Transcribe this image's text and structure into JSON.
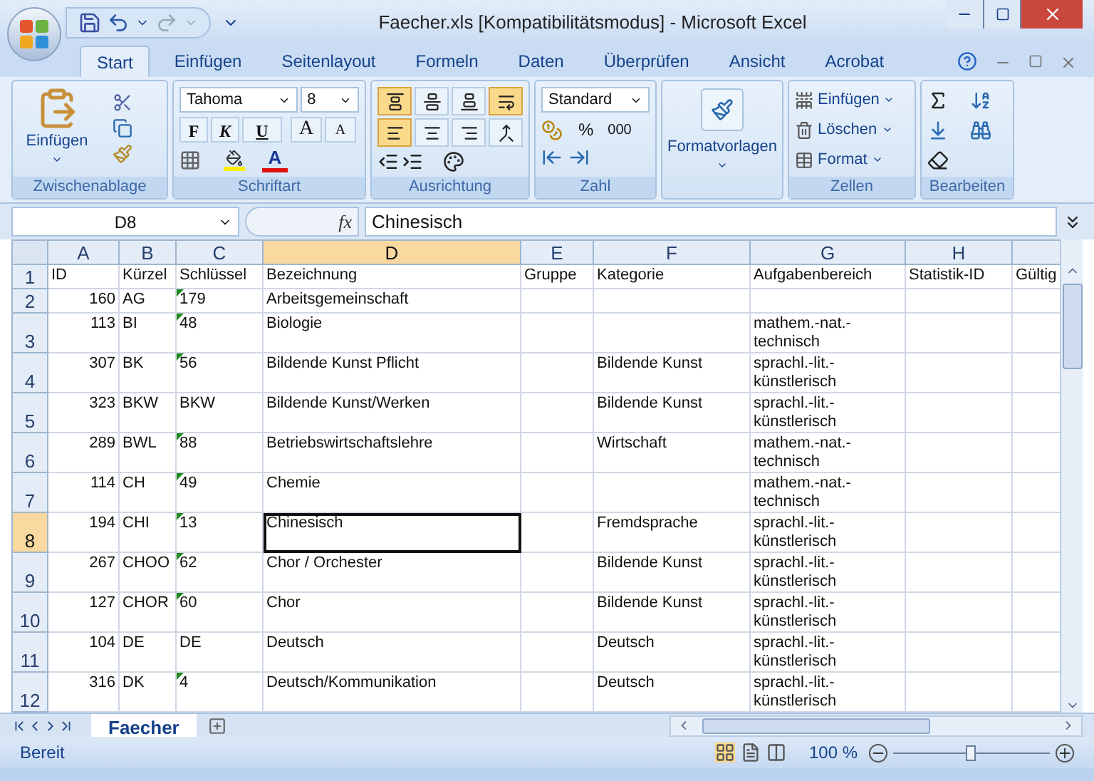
{
  "window": {
    "title": "Faecher.xls  [Kompatibilitätsmodus] - Microsoft Excel"
  },
  "tabs": [
    {
      "label": "Start",
      "selected": true
    },
    {
      "label": "Einfügen",
      "selected": false
    },
    {
      "label": "Seitenlayout",
      "selected": false
    },
    {
      "label": "Formeln",
      "selected": false
    },
    {
      "label": "Daten",
      "selected": false
    },
    {
      "label": "Überprüfen",
      "selected": false
    },
    {
      "label": "Ansicht",
      "selected": false
    },
    {
      "label": "Acrobat",
      "selected": false
    }
  ],
  "ribbon": {
    "clipboard": {
      "paste_label": "Einfügen",
      "group": "Zwischenablage"
    },
    "font": {
      "font_name": "Tahoma",
      "font_size": "8",
      "bold": "F",
      "italic": "K",
      "underline": "U",
      "grow": "A",
      "shrink": "A",
      "font_color": "A",
      "group": "Schriftart"
    },
    "alignment": {
      "buttons": [
        {
          "kind": "top",
          "selected": true
        },
        {
          "kind": "middle",
          "selected": false
        },
        {
          "kind": "bottom",
          "selected": false
        },
        {
          "kind": "wrap",
          "selected": true
        },
        {
          "kind": "left",
          "selected": true
        },
        {
          "kind": "center",
          "selected": false
        },
        {
          "kind": "right",
          "selected": false
        },
        {
          "kind": "merge",
          "selected": false
        }
      ],
      "group": "Ausrichtung"
    },
    "number": {
      "format": "Standard",
      "percent": "%",
      "thousands": "000",
      "group": "Zahl"
    },
    "styles": {
      "label": "Formatvorlagen"
    },
    "cells": {
      "items": [
        {
          "kind": "insert",
          "label": "Einfügen"
        },
        {
          "kind": "delete",
          "label": "Löschen"
        },
        {
          "kind": "format",
          "label": "Format"
        }
      ],
      "group": "Zellen"
    },
    "editing": {
      "group": "Bearbeiten"
    }
  },
  "formula_bar": {
    "name_box": "D8",
    "function_label": "fx",
    "value": "Chinesisch"
  },
  "sheet": {
    "columns": [
      {
        "label": "A",
        "selected": false
      },
      {
        "label": "B",
        "selected": false
      },
      {
        "label": "C",
        "selected": false
      },
      {
        "label": "D",
        "selected": true
      },
      {
        "label": "E",
        "selected": false
      },
      {
        "label": "F",
        "selected": false
      },
      {
        "label": "G",
        "selected": false
      },
      {
        "label": "H",
        "selected": false
      }
    ],
    "rows": [
      {
        "number": "1",
        "selected": false,
        "cells": [
          {
            "text": "ID"
          },
          {
            "text": "Kürzel"
          },
          {
            "text": "Schlüssel"
          },
          {
            "text": "Bezeichnung"
          },
          {
            "text": "Gruppe"
          },
          {
            "text": "Kategorie"
          },
          {
            "text": "Aufgabenbereich"
          },
          {
            "text": "Statistik-ID"
          },
          {
            "text": "Gültig"
          }
        ]
      },
      {
        "number": "2",
        "selected": false,
        "cells": [
          {
            "text": "160"
          },
          {
            "text": "AG"
          },
          {
            "text": "179",
            "flag": true
          },
          {
            "text": "Arbeitsgemeinschaft"
          },
          {},
          {},
          {},
          {},
          {}
        ]
      },
      {
        "number": "3",
        "selected": false,
        "cells": [
          {
            "text": "113"
          },
          {
            "text": "BI"
          },
          {
            "text": "48",
            "flag": true
          },
          {
            "text": "Biologie"
          },
          {},
          {},
          {
            "text": "mathem.-nat.-technisch"
          },
          {},
          {}
        ]
      },
      {
        "number": "4",
        "selected": false,
        "cells": [
          {
            "text": "307"
          },
          {
            "text": "BK"
          },
          {
            "text": "56",
            "flag": true
          },
          {
            "text": "Bildende Kunst Pflicht"
          },
          {},
          {
            "text": "Bildende Kunst"
          },
          {
            "text": "sprachl.-lit.-künstlerisch"
          },
          {},
          {}
        ]
      },
      {
        "number": "5",
        "selected": false,
        "cells": [
          {
            "text": "323"
          },
          {
            "text": "BKW"
          },
          {
            "text": "BKW"
          },
          {
            "text": "Bildende Kunst/Werken"
          },
          {},
          {
            "text": "Bildende Kunst"
          },
          {
            "text": "sprachl.-lit.-künstlerisch"
          },
          {},
          {}
        ]
      },
      {
        "number": "6",
        "selected": false,
        "cells": [
          {
            "text": "289"
          },
          {
            "text": "BWL"
          },
          {
            "text": "88",
            "flag": true
          },
          {
            "text": "Betriebswirtschaftslehre"
          },
          {},
          {
            "text": "Wirtschaft"
          },
          {
            "text": "mathem.-nat.-technisch"
          },
          {},
          {}
        ]
      },
      {
        "number": "7",
        "selected": false,
        "cells": [
          {
            "text": "114"
          },
          {
            "text": "CH"
          },
          {
            "text": "49",
            "flag": true
          },
          {
            "text": "Chemie"
          },
          {},
          {},
          {
            "text": "mathem.-nat.-technisch"
          },
          {},
          {}
        ]
      },
      {
        "number": "8",
        "selected": true,
        "cells": [
          {
            "text": "194"
          },
          {
            "text": "CHI"
          },
          {
            "text": "13",
            "flag": true
          },
          {
            "text": "Chinesisch",
            "selected": true
          },
          {},
          {
            "text": "Fremdsprache"
          },
          {
            "text": "sprachl.-lit.-künstlerisch"
          },
          {},
          {}
        ]
      },
      {
        "number": "9",
        "selected": false,
        "cells": [
          {
            "text": "267"
          },
          {
            "text": "CHOO"
          },
          {
            "text": "62",
            "flag": true
          },
          {
            "text": "Chor / Orchester"
          },
          {},
          {
            "text": "Bildende Kunst"
          },
          {
            "text": "sprachl.-lit.-künstlerisch"
          },
          {},
          {}
        ]
      },
      {
        "number": "10",
        "selected": false,
        "cells": [
          {
            "text": "127"
          },
          {
            "text": "CHOR"
          },
          {
            "text": "60",
            "flag": true
          },
          {
            "text": "Chor"
          },
          {},
          {
            "text": "Bildende Kunst"
          },
          {
            "text": "sprachl.-lit.-künstlerisch"
          },
          {},
          {}
        ]
      },
      {
        "number": "11",
        "selected": false,
        "cells": [
          {
            "text": "104"
          },
          {
            "text": "DE"
          },
          {
            "text": "DE"
          },
          {
            "text": "Deutsch"
          },
          {},
          {
            "text": "Deutsch"
          },
          {
            "text": "sprachl.-lit.-künstlerisch"
          },
          {},
          {}
        ]
      },
      {
        "number": "12",
        "selected": false,
        "cells": [
          {
            "text": "316"
          },
          {
            "text": "DK"
          },
          {
            "text": "4",
            "flag": true
          },
          {
            "text": "Deutsch/Kommunikation"
          },
          {},
          {
            "text": "Deutsch"
          },
          {
            "text": "sprachl.-lit.-künstlerisch"
          },
          {},
          {}
        ]
      }
    ]
  },
  "sheet_tabs": [
    {
      "label": "Faecher",
      "selected": true
    }
  ],
  "status_bar": {
    "status": "Bereit",
    "zoom": "100 %",
    "zoom_slider": {
      "level": 0.5
    }
  }
}
